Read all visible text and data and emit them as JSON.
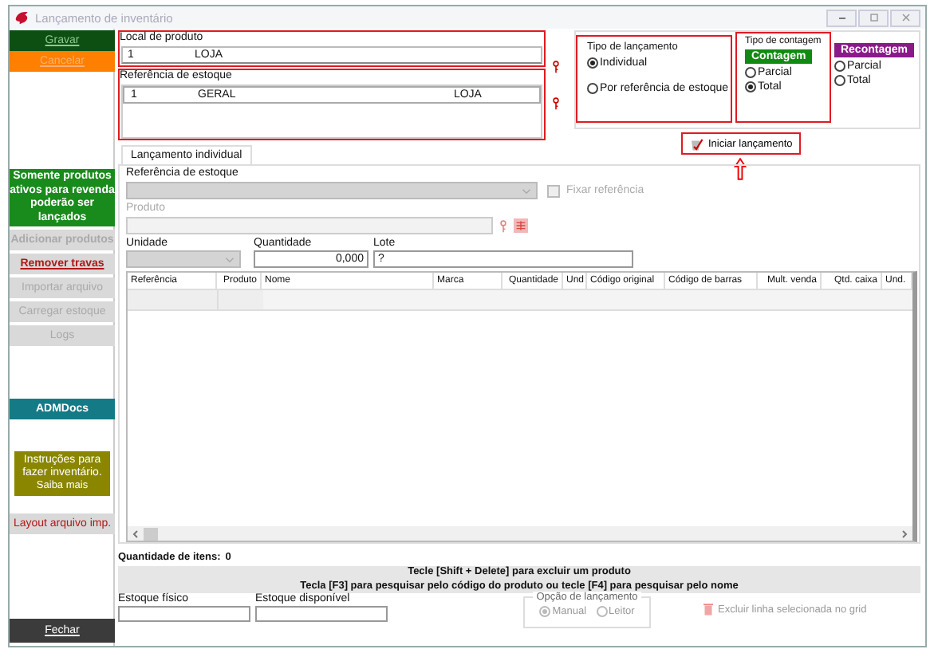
{
  "window": {
    "title": "Lançamento de inventário"
  },
  "sidebar": {
    "items": [
      {
        "kind": "button",
        "label": "Gravar",
        "color": "#0d4f12",
        "disabled": false
      },
      {
        "kind": "button",
        "label": "Cancelar",
        "color": "#ff7f00",
        "disabled": false
      },
      {
        "kind": "notice",
        "label": "Somente produtos ativos para revenda poderão ser lançados",
        "color": "#198a1c"
      },
      {
        "kind": "button",
        "label": "Adicionar produtos",
        "color": "#d9d9d9",
        "disabled": true
      },
      {
        "kind": "link",
        "label": "Remover travas",
        "color": "#d9d9d9"
      },
      {
        "kind": "button",
        "label": "Importar arquivo",
        "color": "#d9d9d9",
        "disabled": true
      },
      {
        "kind": "button",
        "label": "Carregar estoque",
        "color": "#d9d9d9",
        "disabled": true
      },
      {
        "kind": "button",
        "label": "Logs",
        "color": "#d9d9d9",
        "disabled": true
      },
      {
        "kind": "button",
        "label": "ADMDocs",
        "color": "#137a86",
        "disabled": false
      },
      {
        "kind": "info",
        "label": "Instruções para fazer inventário.",
        "link": "Saiba mais",
        "color": "#8a8600"
      },
      {
        "kind": "link",
        "label": "Layout arquivo imp.",
        "color": "#d9d9d9"
      },
      {
        "kind": "button",
        "label": "Fechar",
        "color": "#3b3b3b",
        "disabled": false
      }
    ]
  },
  "local_produto": {
    "label": "Local de produto",
    "code": "1",
    "name": "LOJA"
  },
  "referencia_estoque": {
    "label": "Referência de estoque",
    "rows": [
      {
        "cells": [
          "1",
          "GERAL",
          "LOJA"
        ]
      }
    ]
  },
  "tipo_lancamento": {
    "title": "Tipo de lançamento",
    "options": [
      {
        "label": "Individual",
        "selected": true
      },
      {
        "label": "Por referência de estoque",
        "selected": false
      }
    ]
  },
  "tipo_contagem": {
    "title": "Tipo de contagem",
    "groups": [
      {
        "label": "Contagem",
        "color": "#118a11",
        "options": [
          {
            "label": "Parcial",
            "selected": false
          },
          {
            "label": "Total",
            "selected": true
          }
        ]
      },
      {
        "label": "Recontagem",
        "color": "#8a1a8a",
        "options": [
          {
            "label": "Parcial",
            "selected": false
          },
          {
            "label": "Total",
            "selected": false
          }
        ]
      }
    ]
  },
  "start_button": {
    "label": "Iniciar lançamento"
  },
  "tabs": [
    {
      "label": "Lançamento individual",
      "selected": true
    }
  ],
  "form": {
    "referencia_label": "Referência de estoque",
    "fixar_referencia": {
      "label": "Fixar referência",
      "checked": false
    },
    "produto_label": "Produto",
    "unidade_label": "Unidade",
    "quantidade": {
      "label": "Quantidade",
      "value": "0,000"
    },
    "lote": {
      "label": "Lote",
      "value": "?"
    }
  },
  "grid": {
    "columns": [
      "Referência",
      "Produto",
      "Nome",
      "Marca",
      "Quantidade",
      "Und",
      "Código original",
      "Código de barras",
      "Mult. venda",
      "Qtd. caixa",
      "Und."
    ]
  },
  "item_count": {
    "label": "Quantidade de itens:",
    "value": "0"
  },
  "hints": [
    "Tecle [Shift + Delete] para excluir um produto",
    "Tecla [F3] para pesquisar pelo código do produto ou tecle [F4] para pesquisar pelo nome"
  ],
  "estoque_fisico": {
    "label": "Estoque físico"
  },
  "estoque_disponivel": {
    "label": "Estoque disponível"
  },
  "opcao_lancamento": {
    "title": "Opção de lançamento",
    "disabled": true,
    "options": [
      {
        "label": "Manual",
        "selected": true
      },
      {
        "label": "Leitor",
        "selected": false
      }
    ]
  },
  "delete_button": {
    "label": "Excluir linha selecionada no grid",
    "disabled": true
  }
}
